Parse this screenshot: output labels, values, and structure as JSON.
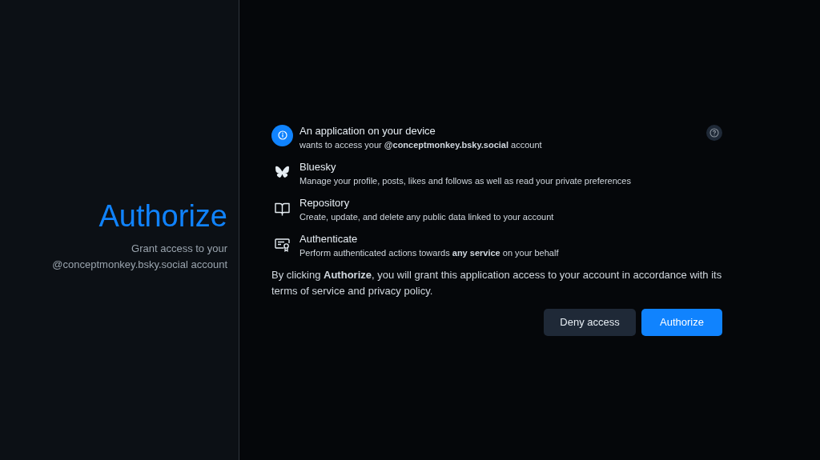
{
  "sidebar": {
    "title": "Authorize",
    "subtitle": "Grant access to your @conceptmonkey.bsky.social account"
  },
  "scopes": [
    {
      "kind": "app",
      "title": "An application on your device",
      "description": "wants to access your **@conceptmonkey.bsky.social** account"
    },
    {
      "kind": "bluesky",
      "title": "Bluesky",
      "description": "Manage your profile, posts, likes and follows as well as read your private preferences"
    },
    {
      "kind": "repository",
      "title": "Repository",
      "description": "Create, update, and delete any public data linked to your account"
    },
    {
      "kind": "authenticate",
      "title": "Authenticate",
      "description": "Perform authenticated actions towards **any service** on your behalf"
    }
  ],
  "notice": "By clicking **Authorize**, you will grant this application access to your account in accordance with its terms of service and privacy policy.",
  "buttons": [
    {
      "kind": "secondary",
      "label": "Deny access"
    },
    {
      "kind": "primary",
      "label": "Authorize"
    }
  ]
}
